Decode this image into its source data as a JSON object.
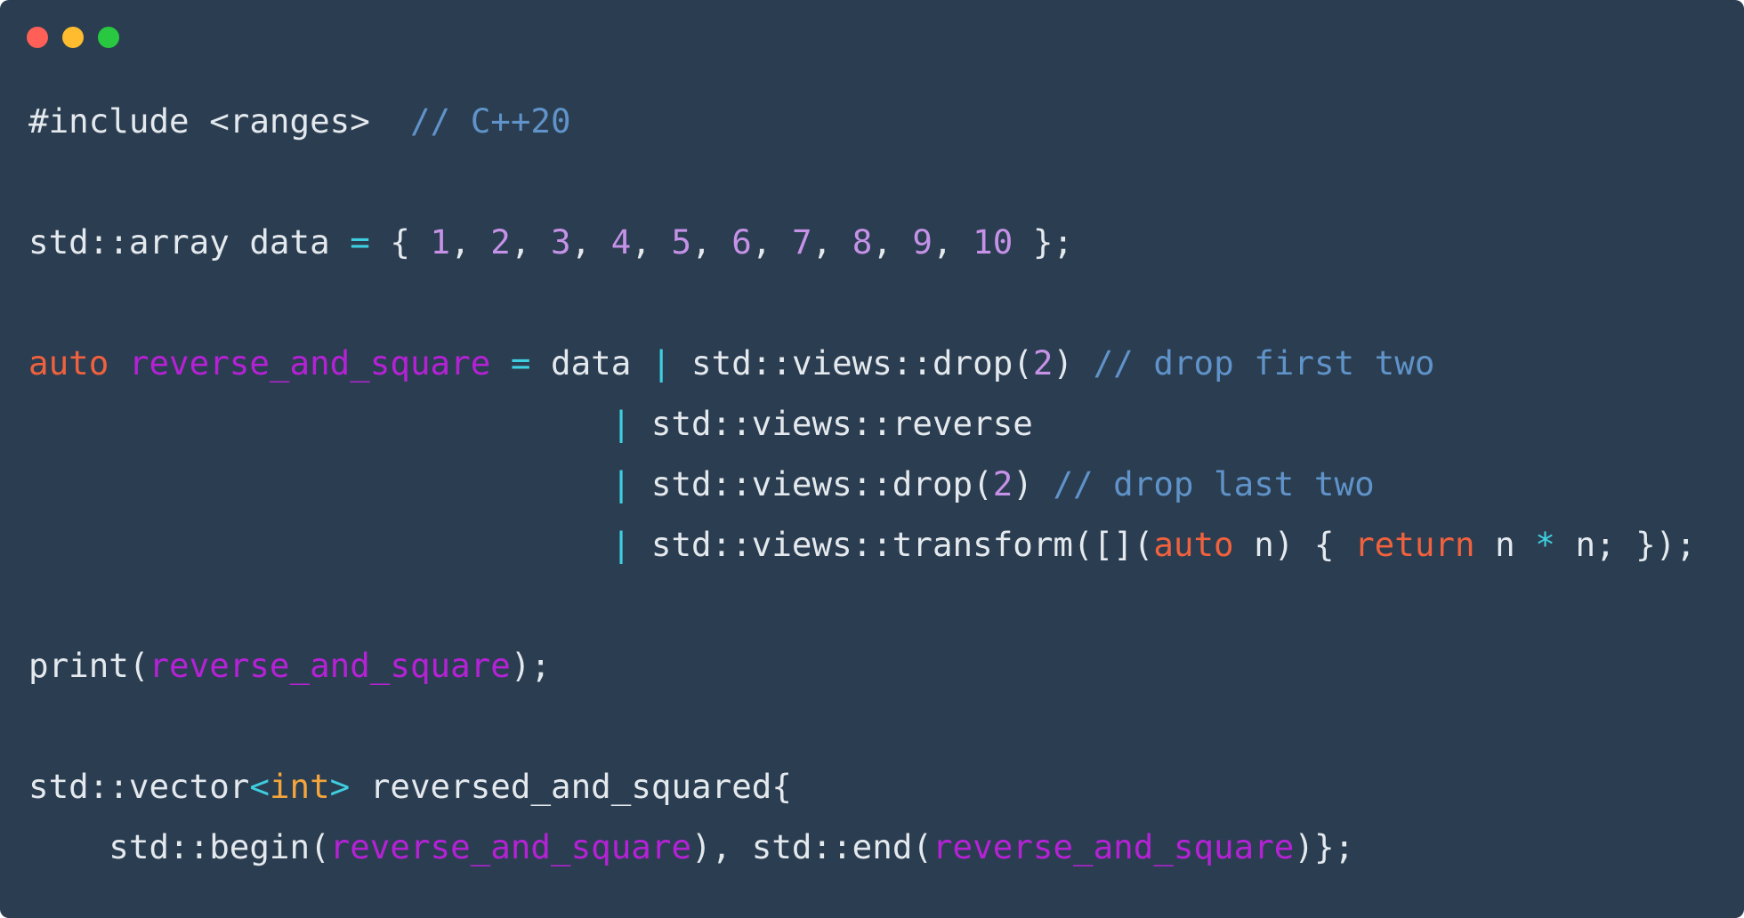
{
  "window": {
    "background": "#2b3d50",
    "traffic_lights": [
      {
        "name": "close-button",
        "color": "#fe5f57"
      },
      {
        "name": "minimize-button",
        "color": "#febc2e"
      },
      {
        "name": "zoom-button",
        "color": "#28c840"
      }
    ]
  },
  "code": {
    "language": "C++",
    "lines": [
      {
        "tokens": [
          {
            "t": "#include <ranges>",
            "c": "default"
          },
          {
            "t": "  ",
            "c": "default"
          },
          {
            "t": "// C++20",
            "c": "comment"
          }
        ]
      },
      {
        "tokens": []
      },
      {
        "tokens": [
          {
            "t": "std::array data ",
            "c": "default"
          },
          {
            "t": "=",
            "c": "op"
          },
          {
            "t": " { ",
            "c": "default"
          },
          {
            "t": "1",
            "c": "number"
          },
          {
            "t": ", ",
            "c": "default"
          },
          {
            "t": "2",
            "c": "number"
          },
          {
            "t": ", ",
            "c": "default"
          },
          {
            "t": "3",
            "c": "number"
          },
          {
            "t": ", ",
            "c": "default"
          },
          {
            "t": "4",
            "c": "number"
          },
          {
            "t": ", ",
            "c": "default"
          },
          {
            "t": "5",
            "c": "number"
          },
          {
            "t": ", ",
            "c": "default"
          },
          {
            "t": "6",
            "c": "number"
          },
          {
            "t": ", ",
            "c": "default"
          },
          {
            "t": "7",
            "c": "number"
          },
          {
            "t": ", ",
            "c": "default"
          },
          {
            "t": "8",
            "c": "number"
          },
          {
            "t": ", ",
            "c": "default"
          },
          {
            "t": "9",
            "c": "number"
          },
          {
            "t": ", ",
            "c": "default"
          },
          {
            "t": "10",
            "c": "number"
          },
          {
            "t": " };",
            "c": "default"
          }
        ]
      },
      {
        "tokens": []
      },
      {
        "tokens": [
          {
            "t": "auto",
            "c": "keyword"
          },
          {
            "t": " ",
            "c": "default"
          },
          {
            "t": "reverse_and_square",
            "c": "ident"
          },
          {
            "t": " ",
            "c": "default"
          },
          {
            "t": "=",
            "c": "op"
          },
          {
            "t": " data ",
            "c": "default"
          },
          {
            "t": "|",
            "c": "op"
          },
          {
            "t": " std::views::drop(",
            "c": "default"
          },
          {
            "t": "2",
            "c": "number"
          },
          {
            "t": ") ",
            "c": "default"
          },
          {
            "t": "// drop first two",
            "c": "comment"
          }
        ]
      },
      {
        "tokens": [
          {
            "t": "                             ",
            "c": "default"
          },
          {
            "t": "|",
            "c": "op"
          },
          {
            "t": " std::views::reverse",
            "c": "default"
          }
        ]
      },
      {
        "tokens": [
          {
            "t": "                             ",
            "c": "default"
          },
          {
            "t": "|",
            "c": "op"
          },
          {
            "t": " std::views::drop(",
            "c": "default"
          },
          {
            "t": "2",
            "c": "number"
          },
          {
            "t": ") ",
            "c": "default"
          },
          {
            "t": "// drop last two",
            "c": "comment"
          }
        ]
      },
      {
        "tokens": [
          {
            "t": "                             ",
            "c": "default"
          },
          {
            "t": "|",
            "c": "op"
          },
          {
            "t": " std::views::transform([](",
            "c": "default"
          },
          {
            "t": "auto",
            "c": "keyword"
          },
          {
            "t": " n) { ",
            "c": "default"
          },
          {
            "t": "return",
            "c": "keyword"
          },
          {
            "t": " n ",
            "c": "default"
          },
          {
            "t": "*",
            "c": "op"
          },
          {
            "t": " n; });",
            "c": "default"
          }
        ]
      },
      {
        "tokens": []
      },
      {
        "tokens": [
          {
            "t": "print(",
            "c": "default"
          },
          {
            "t": "reverse_and_square",
            "c": "ident"
          },
          {
            "t": ");",
            "c": "default"
          }
        ]
      },
      {
        "tokens": []
      },
      {
        "tokens": [
          {
            "t": "std::vector",
            "c": "default"
          },
          {
            "t": "<",
            "c": "op"
          },
          {
            "t": "int",
            "c": "type"
          },
          {
            "t": ">",
            "c": "op"
          },
          {
            "t": " reversed_and_squared{",
            "c": "default"
          }
        ]
      },
      {
        "tokens": [
          {
            "t": "    std::begin(",
            "c": "default"
          },
          {
            "t": "reverse_and_square",
            "c": "ident"
          },
          {
            "t": "), std::end(",
            "c": "default"
          },
          {
            "t": "reverse_and_square",
            "c": "ident"
          },
          {
            "t": ")};",
            "c": "default"
          }
        ]
      }
    ]
  }
}
